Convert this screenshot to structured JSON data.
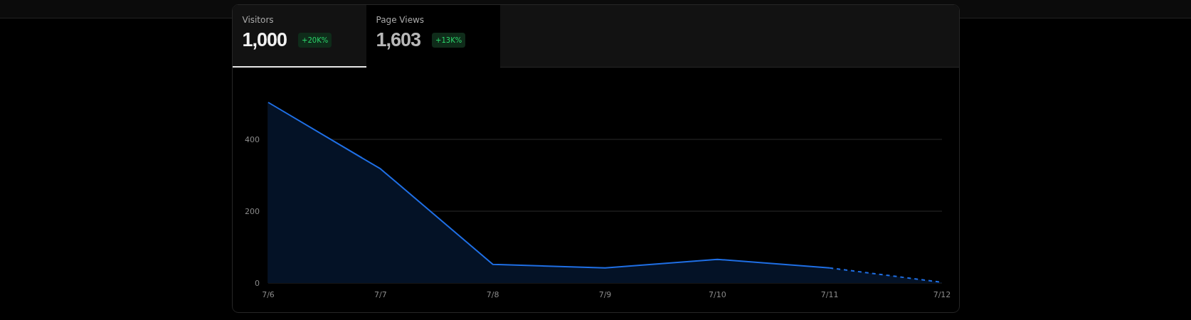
{
  "tabs": [
    {
      "label": "Visitors",
      "value": "1,000",
      "change": "+20K%",
      "selected": true
    },
    {
      "label": "Page Views",
      "value": "1,603",
      "change": "+13K%",
      "selected": false
    }
  ],
  "chart": {
    "chart_data": {
      "type": "area",
      "categories": [
        "7/6",
        "7/7",
        "7/8",
        "7/9",
        "7/10",
        "7/11",
        "7/12"
      ],
      "ylim": [
        0,
        503
      ],
      "yticks": [
        0,
        200,
        400
      ],
      "series": [
        {
          "color": "#1f6fe5",
          "values": [
            503,
            318,
            52,
            42,
            66,
            42,
            2
          ]
        }
      ]
    },
    "last_segment_dashed": true
  }
}
